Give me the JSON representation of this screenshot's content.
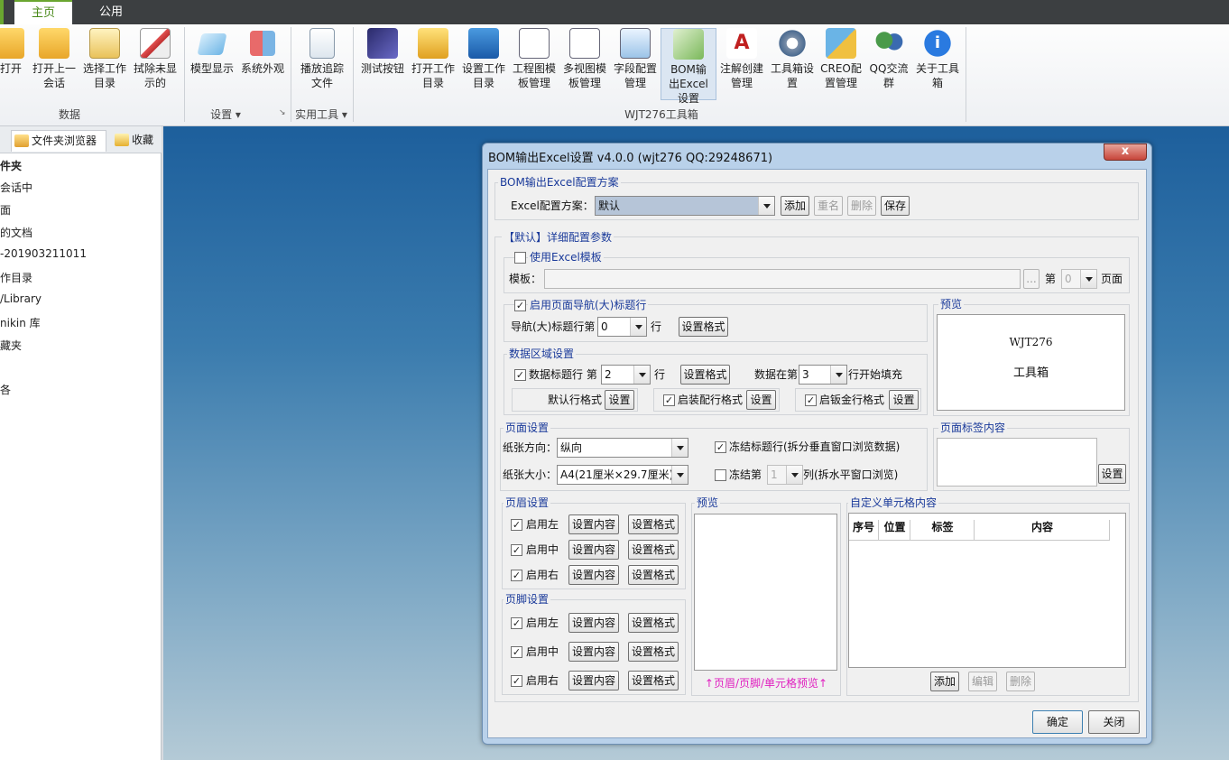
{
  "tabs": {
    "home": "主页",
    "public": "公用"
  },
  "ribbon": {
    "data_group": {
      "label": "数据",
      "buttons": [
        "打开",
        "打开上一会话",
        "选择工作目录",
        "拭除未显示的"
      ]
    },
    "settings_group": {
      "label": "设置",
      "buttons": [
        "模型显示",
        "系统外观"
      ]
    },
    "tools_group": {
      "label": "实用工具",
      "buttons": [
        "播放追踪文件"
      ]
    },
    "wjt_group": {
      "label": "WJT276工具箱",
      "buttons": [
        "测试按钮",
        "打开工作目录",
        "设置工作目录",
        "工程图模板管理",
        "多视图模板管理",
        "字段配置管理",
        "BOM输出Excel设置",
        "注解创建管理",
        "工具箱设置",
        "CREO配置管理",
        "QQ交流群",
        "关于工具箱"
      ]
    }
  },
  "left_panel": {
    "tab_browser": "文件夹浏览器",
    "tab_favorites": "收藏",
    "items": [
      "件夹",
      "会话中",
      "面",
      "的文档",
      "-201903211011",
      "作目录",
      "/Library",
      "nikin 库",
      "藏夹",
      "",
      "各"
    ]
  },
  "dialog": {
    "title": "BOM输出Excel设置 v4.0.0 (wjt276 QQ:29248671)",
    "close": "x",
    "scheme_group": "BOM输出Excel配置方案",
    "scheme_label": "Excel配置方案：",
    "scheme_value": "默认",
    "btn_add": "添加",
    "btn_rename": "重名",
    "btn_delete": "删除",
    "btn_save": "保存",
    "detail_group": "【默认】详细配置参数",
    "use_template": "使用Excel模板",
    "template_label": "模板：",
    "template_browse": "...",
    "page_prefix": "第",
    "page_value": "0",
    "page_suffix": "页面",
    "nav_title_enable": "启用页面导航(大)标题行",
    "nav_title_row_label": "导航(大)标题行第",
    "nav_title_row_value": "0",
    "row_suffix": "行",
    "set_format": "设置格式",
    "preview_group": "预览",
    "preview_line1": "WJT276",
    "preview_line2": "工具箱",
    "data_area_group": "数据区域设置",
    "data_title_row": "数据标题行 第",
    "data_title_row_value": "2",
    "data_start_label": "数据在第",
    "data_start_value": "3",
    "data_start_suffix": "行开始填充",
    "default_row_format": "默认行格式",
    "btn_set": "设置",
    "assembly_row_format": "启装配行格式",
    "sheetmetal_row_format": "启钣金行格式",
    "page_settings_group": "页面设置",
    "paper_orient_label": "纸张方向：",
    "paper_orient_value": "纵向",
    "freeze_title": "冻结标题行(拆分垂直窗口浏览数据)",
    "paper_size_label": "纸张大小：",
    "paper_size_value": "A4(21厘米×29.7厘米)",
    "freeze_col_prefix": "冻结第",
    "freeze_col_value": "1",
    "freeze_col_suffix": "列(拆水平窗口浏览)",
    "page_tag_group": "页面标签内容",
    "header_group": "页眉设置",
    "footer_group": "页脚设置",
    "enable_left": "启用左",
    "enable_center": "启用中",
    "enable_right": "启用右",
    "set_content": "设置内容",
    "preview2_group": "预览",
    "preview2_note": "↑页眉/页脚/单元格预览↑",
    "custom_cell_group": "自定义单元格内容",
    "table_headers": [
      "序号",
      "位置",
      "标签",
      "内容"
    ],
    "btn_edit": "编辑",
    "btn_ok": "确定",
    "btn_close": "关闭"
  },
  "colors": {
    "accent_green": "#6aa630",
    "title_blue": "#1a3a9a",
    "note_magenta": "#e020c0"
  }
}
